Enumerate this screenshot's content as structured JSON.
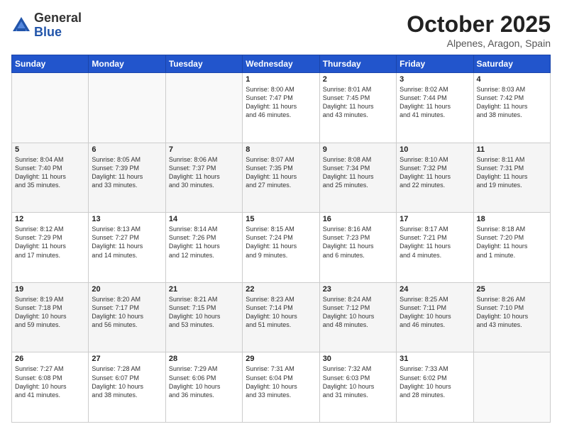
{
  "logo": {
    "general": "General",
    "blue": "Blue"
  },
  "title": {
    "month": "October 2025",
    "location": "Alpenes, Aragon, Spain"
  },
  "weekdays": [
    "Sunday",
    "Monday",
    "Tuesday",
    "Wednesday",
    "Thursday",
    "Friday",
    "Saturday"
  ],
  "weeks": [
    [
      {
        "day": "",
        "info": ""
      },
      {
        "day": "",
        "info": ""
      },
      {
        "day": "",
        "info": ""
      },
      {
        "day": "1",
        "info": "Sunrise: 8:00 AM\nSunset: 7:47 PM\nDaylight: 11 hours\nand 46 minutes."
      },
      {
        "day": "2",
        "info": "Sunrise: 8:01 AM\nSunset: 7:45 PM\nDaylight: 11 hours\nand 43 minutes."
      },
      {
        "day": "3",
        "info": "Sunrise: 8:02 AM\nSunset: 7:44 PM\nDaylight: 11 hours\nand 41 minutes."
      },
      {
        "day": "4",
        "info": "Sunrise: 8:03 AM\nSunset: 7:42 PM\nDaylight: 11 hours\nand 38 minutes."
      }
    ],
    [
      {
        "day": "5",
        "info": "Sunrise: 8:04 AM\nSunset: 7:40 PM\nDaylight: 11 hours\nand 35 minutes."
      },
      {
        "day": "6",
        "info": "Sunrise: 8:05 AM\nSunset: 7:39 PM\nDaylight: 11 hours\nand 33 minutes."
      },
      {
        "day": "7",
        "info": "Sunrise: 8:06 AM\nSunset: 7:37 PM\nDaylight: 11 hours\nand 30 minutes."
      },
      {
        "day": "8",
        "info": "Sunrise: 8:07 AM\nSunset: 7:35 PM\nDaylight: 11 hours\nand 27 minutes."
      },
      {
        "day": "9",
        "info": "Sunrise: 8:08 AM\nSunset: 7:34 PM\nDaylight: 11 hours\nand 25 minutes."
      },
      {
        "day": "10",
        "info": "Sunrise: 8:10 AM\nSunset: 7:32 PM\nDaylight: 11 hours\nand 22 minutes."
      },
      {
        "day": "11",
        "info": "Sunrise: 8:11 AM\nSunset: 7:31 PM\nDaylight: 11 hours\nand 19 minutes."
      }
    ],
    [
      {
        "day": "12",
        "info": "Sunrise: 8:12 AM\nSunset: 7:29 PM\nDaylight: 11 hours\nand 17 minutes."
      },
      {
        "day": "13",
        "info": "Sunrise: 8:13 AM\nSunset: 7:27 PM\nDaylight: 11 hours\nand 14 minutes."
      },
      {
        "day": "14",
        "info": "Sunrise: 8:14 AM\nSunset: 7:26 PM\nDaylight: 11 hours\nand 12 minutes."
      },
      {
        "day": "15",
        "info": "Sunrise: 8:15 AM\nSunset: 7:24 PM\nDaylight: 11 hours\nand 9 minutes."
      },
      {
        "day": "16",
        "info": "Sunrise: 8:16 AM\nSunset: 7:23 PM\nDaylight: 11 hours\nand 6 minutes."
      },
      {
        "day": "17",
        "info": "Sunrise: 8:17 AM\nSunset: 7:21 PM\nDaylight: 11 hours\nand 4 minutes."
      },
      {
        "day": "18",
        "info": "Sunrise: 8:18 AM\nSunset: 7:20 PM\nDaylight: 11 hours\nand 1 minute."
      }
    ],
    [
      {
        "day": "19",
        "info": "Sunrise: 8:19 AM\nSunset: 7:18 PM\nDaylight: 10 hours\nand 59 minutes."
      },
      {
        "day": "20",
        "info": "Sunrise: 8:20 AM\nSunset: 7:17 PM\nDaylight: 10 hours\nand 56 minutes."
      },
      {
        "day": "21",
        "info": "Sunrise: 8:21 AM\nSunset: 7:15 PM\nDaylight: 10 hours\nand 53 minutes."
      },
      {
        "day": "22",
        "info": "Sunrise: 8:23 AM\nSunset: 7:14 PM\nDaylight: 10 hours\nand 51 minutes."
      },
      {
        "day": "23",
        "info": "Sunrise: 8:24 AM\nSunset: 7:12 PM\nDaylight: 10 hours\nand 48 minutes."
      },
      {
        "day": "24",
        "info": "Sunrise: 8:25 AM\nSunset: 7:11 PM\nDaylight: 10 hours\nand 46 minutes."
      },
      {
        "day": "25",
        "info": "Sunrise: 8:26 AM\nSunset: 7:10 PM\nDaylight: 10 hours\nand 43 minutes."
      }
    ],
    [
      {
        "day": "26",
        "info": "Sunrise: 7:27 AM\nSunset: 6:08 PM\nDaylight: 10 hours\nand 41 minutes."
      },
      {
        "day": "27",
        "info": "Sunrise: 7:28 AM\nSunset: 6:07 PM\nDaylight: 10 hours\nand 38 minutes."
      },
      {
        "day": "28",
        "info": "Sunrise: 7:29 AM\nSunset: 6:06 PM\nDaylight: 10 hours\nand 36 minutes."
      },
      {
        "day": "29",
        "info": "Sunrise: 7:31 AM\nSunset: 6:04 PM\nDaylight: 10 hours\nand 33 minutes."
      },
      {
        "day": "30",
        "info": "Sunrise: 7:32 AM\nSunset: 6:03 PM\nDaylight: 10 hours\nand 31 minutes."
      },
      {
        "day": "31",
        "info": "Sunrise: 7:33 AM\nSunset: 6:02 PM\nDaylight: 10 hours\nand 28 minutes."
      },
      {
        "day": "",
        "info": ""
      }
    ]
  ]
}
